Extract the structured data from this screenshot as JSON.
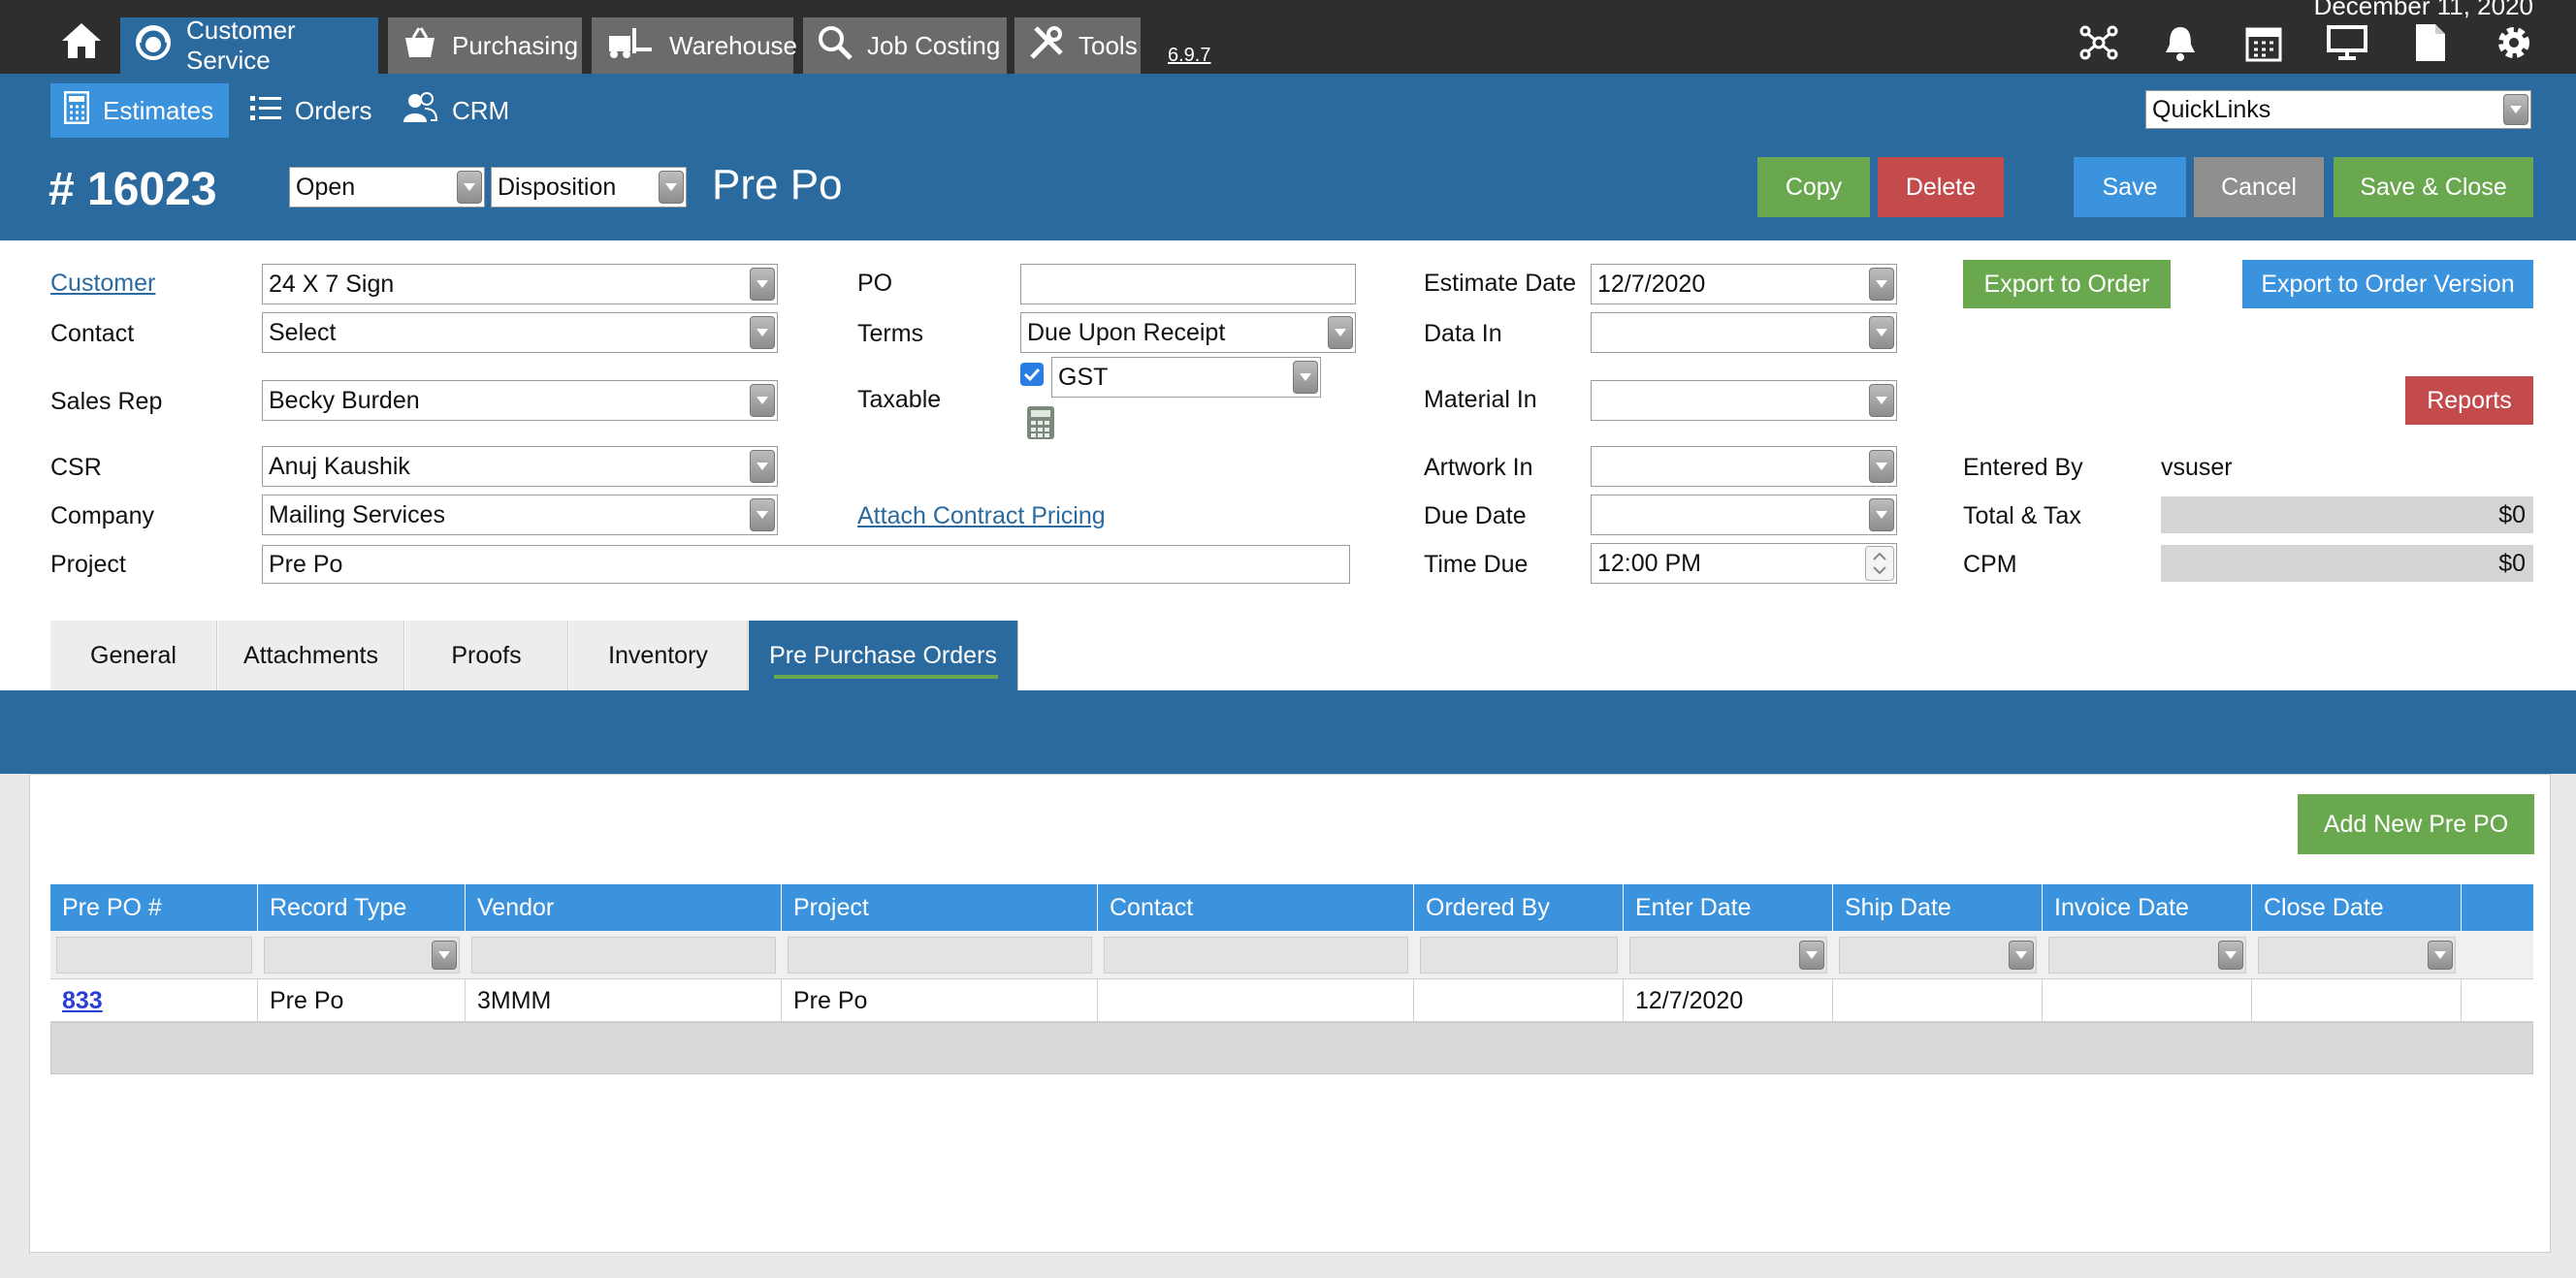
{
  "top_nav": {
    "items": [
      {
        "label": "Customer Service",
        "icon": "headset-icon",
        "active": true
      },
      {
        "label": "Purchasing",
        "icon": "basket-icon"
      },
      {
        "label": "Warehouse",
        "icon": "forklift-icon"
      },
      {
        "label": "Job Costing",
        "icon": "magnifier-icon"
      },
      {
        "label": "Tools",
        "icon": "tools-icon"
      }
    ],
    "version": "6.9.7",
    "date": "December 11, 2020",
    "right_icons": [
      "network-icon",
      "bell-icon",
      "calendar-icon",
      "monitor-icon",
      "document-icon",
      "gear-icon"
    ]
  },
  "sub_nav": {
    "items": [
      {
        "label": "Estimates",
        "icon": "calculator-icon",
        "active": true
      },
      {
        "label": "Orders",
        "icon": "list-icon"
      },
      {
        "label": "CRM",
        "icon": "people-icon"
      }
    ],
    "quicklinks": "QuickLinks"
  },
  "header": {
    "estimate_number": "# 16023",
    "status": "Open",
    "disposition": "Disposition",
    "disposition_value": "Pre Po",
    "buttons": {
      "copy": "Copy",
      "delete": "Delete",
      "save": "Save",
      "cancel": "Cancel",
      "save_close": "Save & Close"
    }
  },
  "form": {
    "customer_label": "Customer",
    "customer": "24 X 7 Sign",
    "contact_label": "Contact",
    "contact": "Select",
    "sales_rep_label": "Sales Rep",
    "sales_rep": "Becky Burden",
    "csr_label": "CSR",
    "csr": "Anuj Kaushik",
    "company_label": "Company",
    "company": "Mailing Services",
    "project_label": "Project",
    "project": "Pre Po",
    "po_label": "PO",
    "po": "",
    "terms_label": "Terms",
    "terms": "Due Upon Receipt",
    "taxable_label": "Taxable",
    "taxable_checked": true,
    "tax": "GST",
    "attach_contract_pricing": "Attach Contract Pricing",
    "estimate_date_label": "Estimate Date",
    "estimate_date": "12/7/2020",
    "data_in_label": "Data In",
    "data_in": "",
    "material_in_label": "Material In",
    "material_in": "",
    "artwork_in_label": "Artwork In",
    "artwork_in": "",
    "due_date_label": "Due Date",
    "due_date": "",
    "time_due_label": "Time Due",
    "time_due": "12:00 PM",
    "export_to_order": "Export to Order",
    "export_to_order_version": "Export to Order Version",
    "reports": "Reports",
    "entered_by_label": "Entered By",
    "entered_by": "vsuser",
    "total_tax_label": "Total & Tax",
    "total_tax": "$0",
    "cpm_label": "CPM",
    "cpm": "$0"
  },
  "tabs": [
    "General",
    "Attachments",
    "Proofs",
    "Inventory",
    "Pre Purchase Orders"
  ],
  "active_tab": "Pre Purchase Orders",
  "pre_po": {
    "add_button": "Add New Pre PO",
    "columns": [
      "Pre PO #",
      "Record Type",
      "Vendor",
      "Project",
      "Contact",
      "Ordered By",
      "Enter Date",
      "Ship Date",
      "Invoice Date",
      "Close Date"
    ],
    "rows": [
      [
        "833",
        "Pre Po",
        "3MMM",
        "Pre Po",
        "",
        "",
        "12/7/2020",
        "",
        "",
        ""
      ]
    ]
  },
  "colors": {
    "nav_dark": "#2e2e2e",
    "header_blue": "#2b6a9e",
    "accent_blue": "#3a93dc",
    "green": "#6aa84f",
    "red": "#c44b4b"
  }
}
